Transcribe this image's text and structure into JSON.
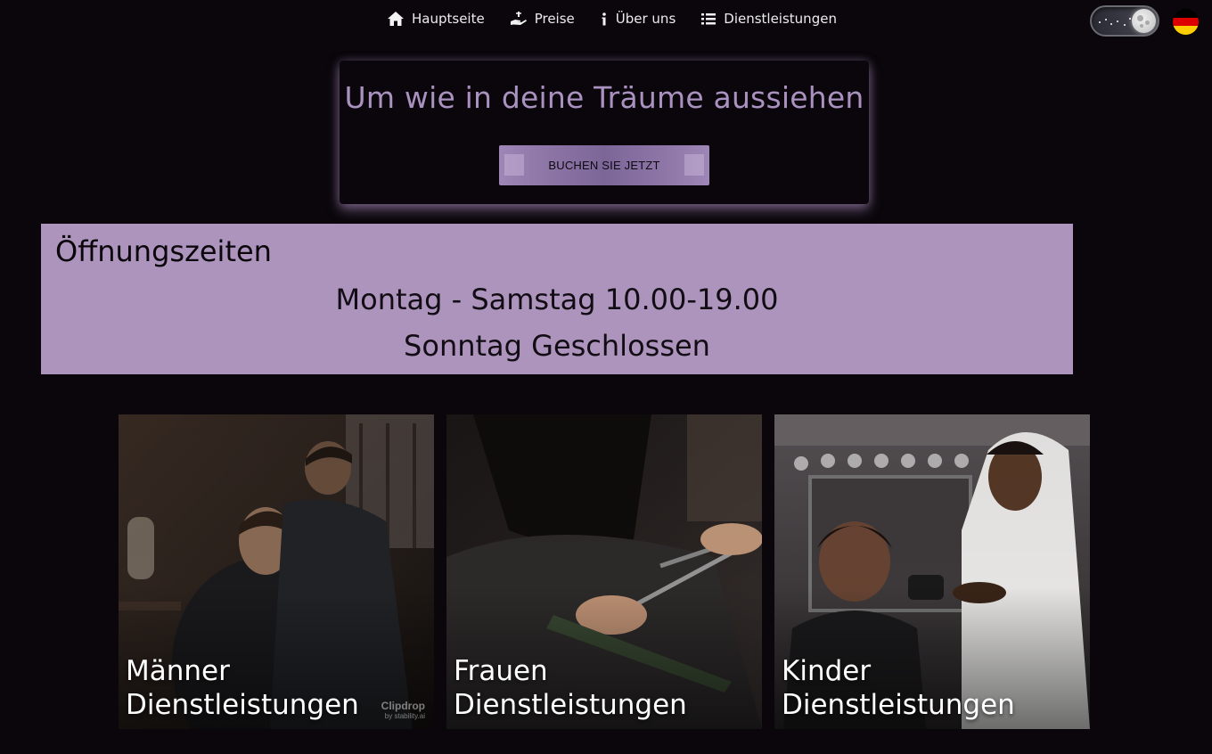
{
  "nav": {
    "items": [
      {
        "label": "Hauptseite",
        "icon": "home-icon"
      },
      {
        "label": "Preise",
        "icon": "hand-money-icon"
      },
      {
        "label": "Über uns",
        "icon": "info-icon"
      },
      {
        "label": "Dienstleistungen",
        "icon": "list-icon"
      }
    ],
    "theme_toggle": {
      "state": "dark",
      "icon": "moon-icon"
    },
    "language": {
      "icon": "german-flag-icon",
      "colors": [
        "#000000",
        "#dd0000",
        "#ffce00"
      ]
    }
  },
  "hero": {
    "title": "Um wie in deine Träume aussiehen",
    "button_label": "BUCHEN SIE JETZT"
  },
  "hours": {
    "title": "Öffnungszeiten",
    "lines": [
      "Montag - Samstag 10.00-19.00",
      "Sonntag Geschlossen"
    ]
  },
  "cards": [
    {
      "line1": "Männer",
      "line2": "Dienstleistungen",
      "image": "barber-men-photo",
      "watermark": {
        "brand": "Clipdrop",
        "by": "by stability.ai"
      }
    },
    {
      "line1": "Frauen",
      "line2": "Dienstleistungen",
      "image": "women-haircut-photo"
    },
    {
      "line1": "Kinder",
      "line2": "Dienstleistungen",
      "image": "kids-haircut-photo"
    }
  ],
  "colors": {
    "background": "#0a060b",
    "accent": "#ad94bc",
    "hero_title": "#a992bf"
  }
}
